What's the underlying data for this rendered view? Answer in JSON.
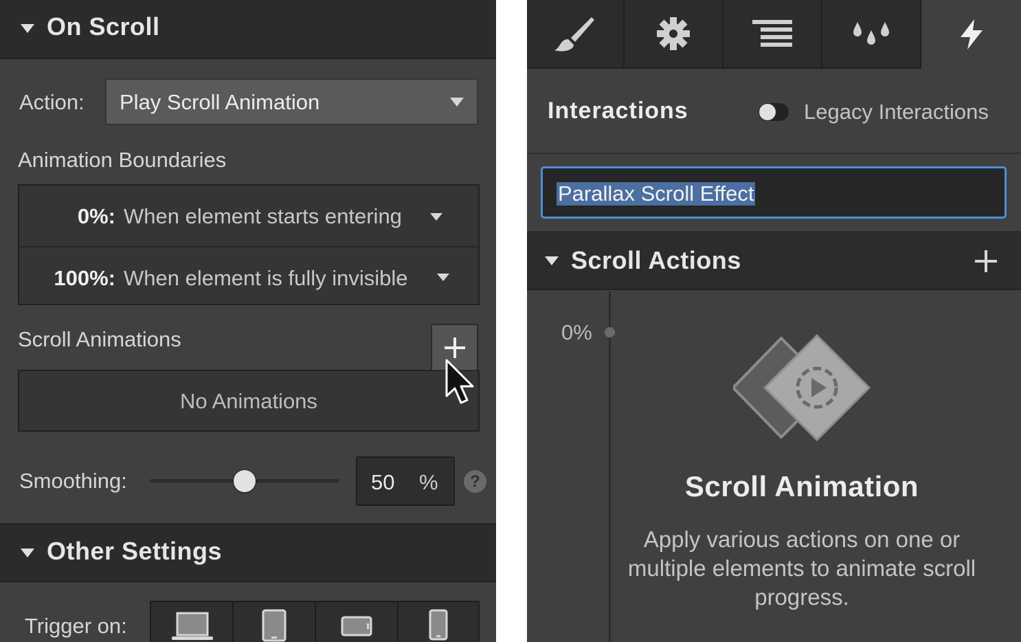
{
  "left_panel": {
    "on_scroll": {
      "title": "On Scroll"
    },
    "action": {
      "label": "Action:",
      "value": "Play Scroll Animation"
    },
    "animation_boundaries": {
      "label": "Animation Boundaries",
      "rows": [
        {
          "percent": "0%:",
          "text": "When element starts entering"
        },
        {
          "percent": "100%:",
          "text": "When element is fully invisible"
        }
      ]
    },
    "scroll_animations": {
      "label": "Scroll Animations",
      "empty_text": "No Animations"
    },
    "smoothing": {
      "label": "Smoothing:",
      "value": "50",
      "unit": "%",
      "level_percent": 50,
      "help": "?"
    },
    "other_settings": {
      "title": "Other Settings"
    },
    "trigger_on": {
      "label": "Trigger on:",
      "devices": [
        "laptop-icon",
        "tablet-icon",
        "tablet-landscape-icon",
        "phone-icon"
      ]
    }
  },
  "right_panel": {
    "tabs": [
      "brush-icon",
      "gear-icon",
      "align-icon",
      "drops-icon",
      "lightning-icon"
    ],
    "active_tab": "lightning-icon",
    "header": {
      "title": "Interactions",
      "toggle_label": "Legacy Interactions",
      "toggle_on": false
    },
    "name_input": {
      "value": "Parallax Scroll Effect"
    },
    "scroll_actions": {
      "title": "Scroll Actions"
    },
    "timeline": {
      "start_percent": "0%"
    },
    "empty_state": {
      "icon": "scroll-animation-icon",
      "title": "Scroll Animation",
      "description": "Apply various actions on one or multiple elements to animate scroll progress."
    }
  },
  "colors": {
    "panel_bg": "#404040",
    "header_bg": "#2b2b2b",
    "focus_blue": "#4a90d9",
    "selection": "#4a6fa0"
  }
}
